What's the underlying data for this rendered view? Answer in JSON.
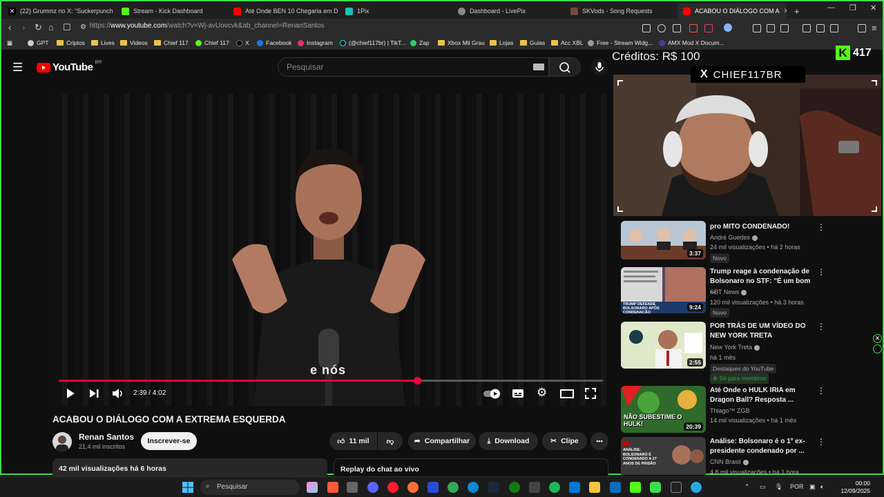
{
  "browser": {
    "tabs": [
      {
        "label": "(22) Grummz no X: \"Suckerpunch Se",
        "color": "#000000"
      },
      {
        "label": "Stream - Kick Dashboard",
        "color": "#53fc18"
      },
      {
        "label": "Até Onde BEN 10 Chegaria em Drag",
        "color": "#ff0000"
      },
      {
        "label": "1Pix",
        "color": "#17c3b2"
      },
      {
        "label": "Dashboard - LivePix",
        "color": "#888888"
      },
      {
        "label": "SKVods - Song Requests",
        "color": "#6b4e3d"
      },
      {
        "label": "ACABOU O DIÁLOGO COM A",
        "color": "#ff0000"
      }
    ],
    "new_tab": "+",
    "url_prefix": "https://",
    "url_host": "www.youtube.com",
    "url_path": "/watch?v=Wj-avUovcvk&ab_channel=RenanSantos",
    "bookmarks": [
      {
        "label": "GPT",
        "icon": "gpt-icon"
      },
      {
        "label": "Criptos",
        "icon": "folder-icon"
      },
      {
        "label": "Lives",
        "icon": "folder-icon"
      },
      {
        "label": "Videos",
        "icon": "folder-icon"
      },
      {
        "label": "Chief 117",
        "icon": "folder-icon"
      },
      {
        "label": "Chief 117",
        "icon": "kick-icon"
      },
      {
        "label": "X",
        "icon": "x-icon"
      },
      {
        "label": "Facebook",
        "icon": "facebook-icon"
      },
      {
        "label": "Instagram",
        "icon": "instagram-icon"
      },
      {
        "label": "(@chief117br) | TikT...",
        "icon": "tiktok-icon"
      },
      {
        "label": "Zap",
        "icon": "whatsapp-icon"
      },
      {
        "label": "Xbox Mil Grau",
        "icon": "folder-icon"
      },
      {
        "label": "Lojas",
        "icon": "folder-icon"
      },
      {
        "label": "Guias",
        "icon": "folder-icon"
      },
      {
        "label": "Acc XBL",
        "icon": "folder-icon"
      },
      {
        "label": "Free - Stream Widg...",
        "icon": "globe-icon"
      },
      {
        "label": "AMX Mod X Docum...",
        "icon": "amx-icon"
      }
    ]
  },
  "youtube": {
    "logo_text": "YouTube",
    "region": "BR",
    "search_placeholder": "Pesquisar",
    "player": {
      "caption": "e nós",
      "current_time": "2:39",
      "duration": "4:02",
      "time_display": "2:39 / 4:02",
      "progress_fraction": 0.659
    },
    "video_title": "ACABOU O DIÁLOGO COM A EXTREMA ESQUERDA",
    "channel_name": "Renan Santos",
    "subscribers": "21,4 mil inscritos",
    "subscribe_label": "Inscrever-se",
    "likes": "11 mil",
    "share_label": "Compartilhar",
    "download_label": "Download",
    "clip_label": "Clipe",
    "more_label": "•••",
    "views_line": "42 mil visualizações  há 6 horas",
    "chat_replay": "Replay do chat ao vivo"
  },
  "overlay": {
    "credits": "Créditos: R$ 100",
    "kick_letter": "K",
    "kick_viewers": "417",
    "x_letter": "X",
    "x_handle": "CHIEF117BR"
  },
  "recommendations": [
    {
      "title": "pro MITO CONDENADO!",
      "channel": "André Guedes",
      "verified": true,
      "meta": "24 mil visualizações • há 2 horas",
      "badge": "Novo",
      "duration": "3:37",
      "thumb_color": "#8aa0b8"
    },
    {
      "title": "Trump reage à condenação de Bolsonaro no STF: \"É um bom ...",
      "channel": "SBT News",
      "verified": true,
      "meta": "120 mil visualizações • há 3 horas",
      "badge": "Novo",
      "duration": "9:24",
      "thumb_color": "#5a4a5a",
      "thumb_text": "TRUMP DEFENDE BOLSONARO APÓS CONDENAÇÃO"
    },
    {
      "title": "POR TRÁS DE UM VÍDEO DO NEW YORK TRETA",
      "channel": "New York Treta",
      "verified": true,
      "meta": "há 1 mês",
      "badge": "Destaques do YouTube",
      "member": "Só para membros",
      "duration": "2:55",
      "thumb_color": "#c8d8b0"
    },
    {
      "title": "Até Onde o HULK IRIA em Dragon Ball? Resposta ...",
      "channel": "Thiago™ ZGB",
      "verified": false,
      "meta": "14 mil visualizações • há 1 mês",
      "duration": "20:39",
      "thumb_color": "#2f6a2a",
      "thumb_text": "NÃO SUBESTIME O HULK!"
    },
    {
      "title": "Análise: Bolsonaro é o 1º ex-presidente condenado por ...",
      "channel": "CNN Brasil",
      "verified": true,
      "meta": "4,8 mil visualizações • há 1 hora",
      "thumb_color": "#3a3a3a",
      "thumb_text": "ANÁLISE: BOLSONARO É CONDENADO A 27 ANOS DE PRISÃO"
    }
  ],
  "taskbar": {
    "search_placeholder": "Pesquisar",
    "language": "POR",
    "time": "00:00",
    "date": "12/09/2025"
  }
}
